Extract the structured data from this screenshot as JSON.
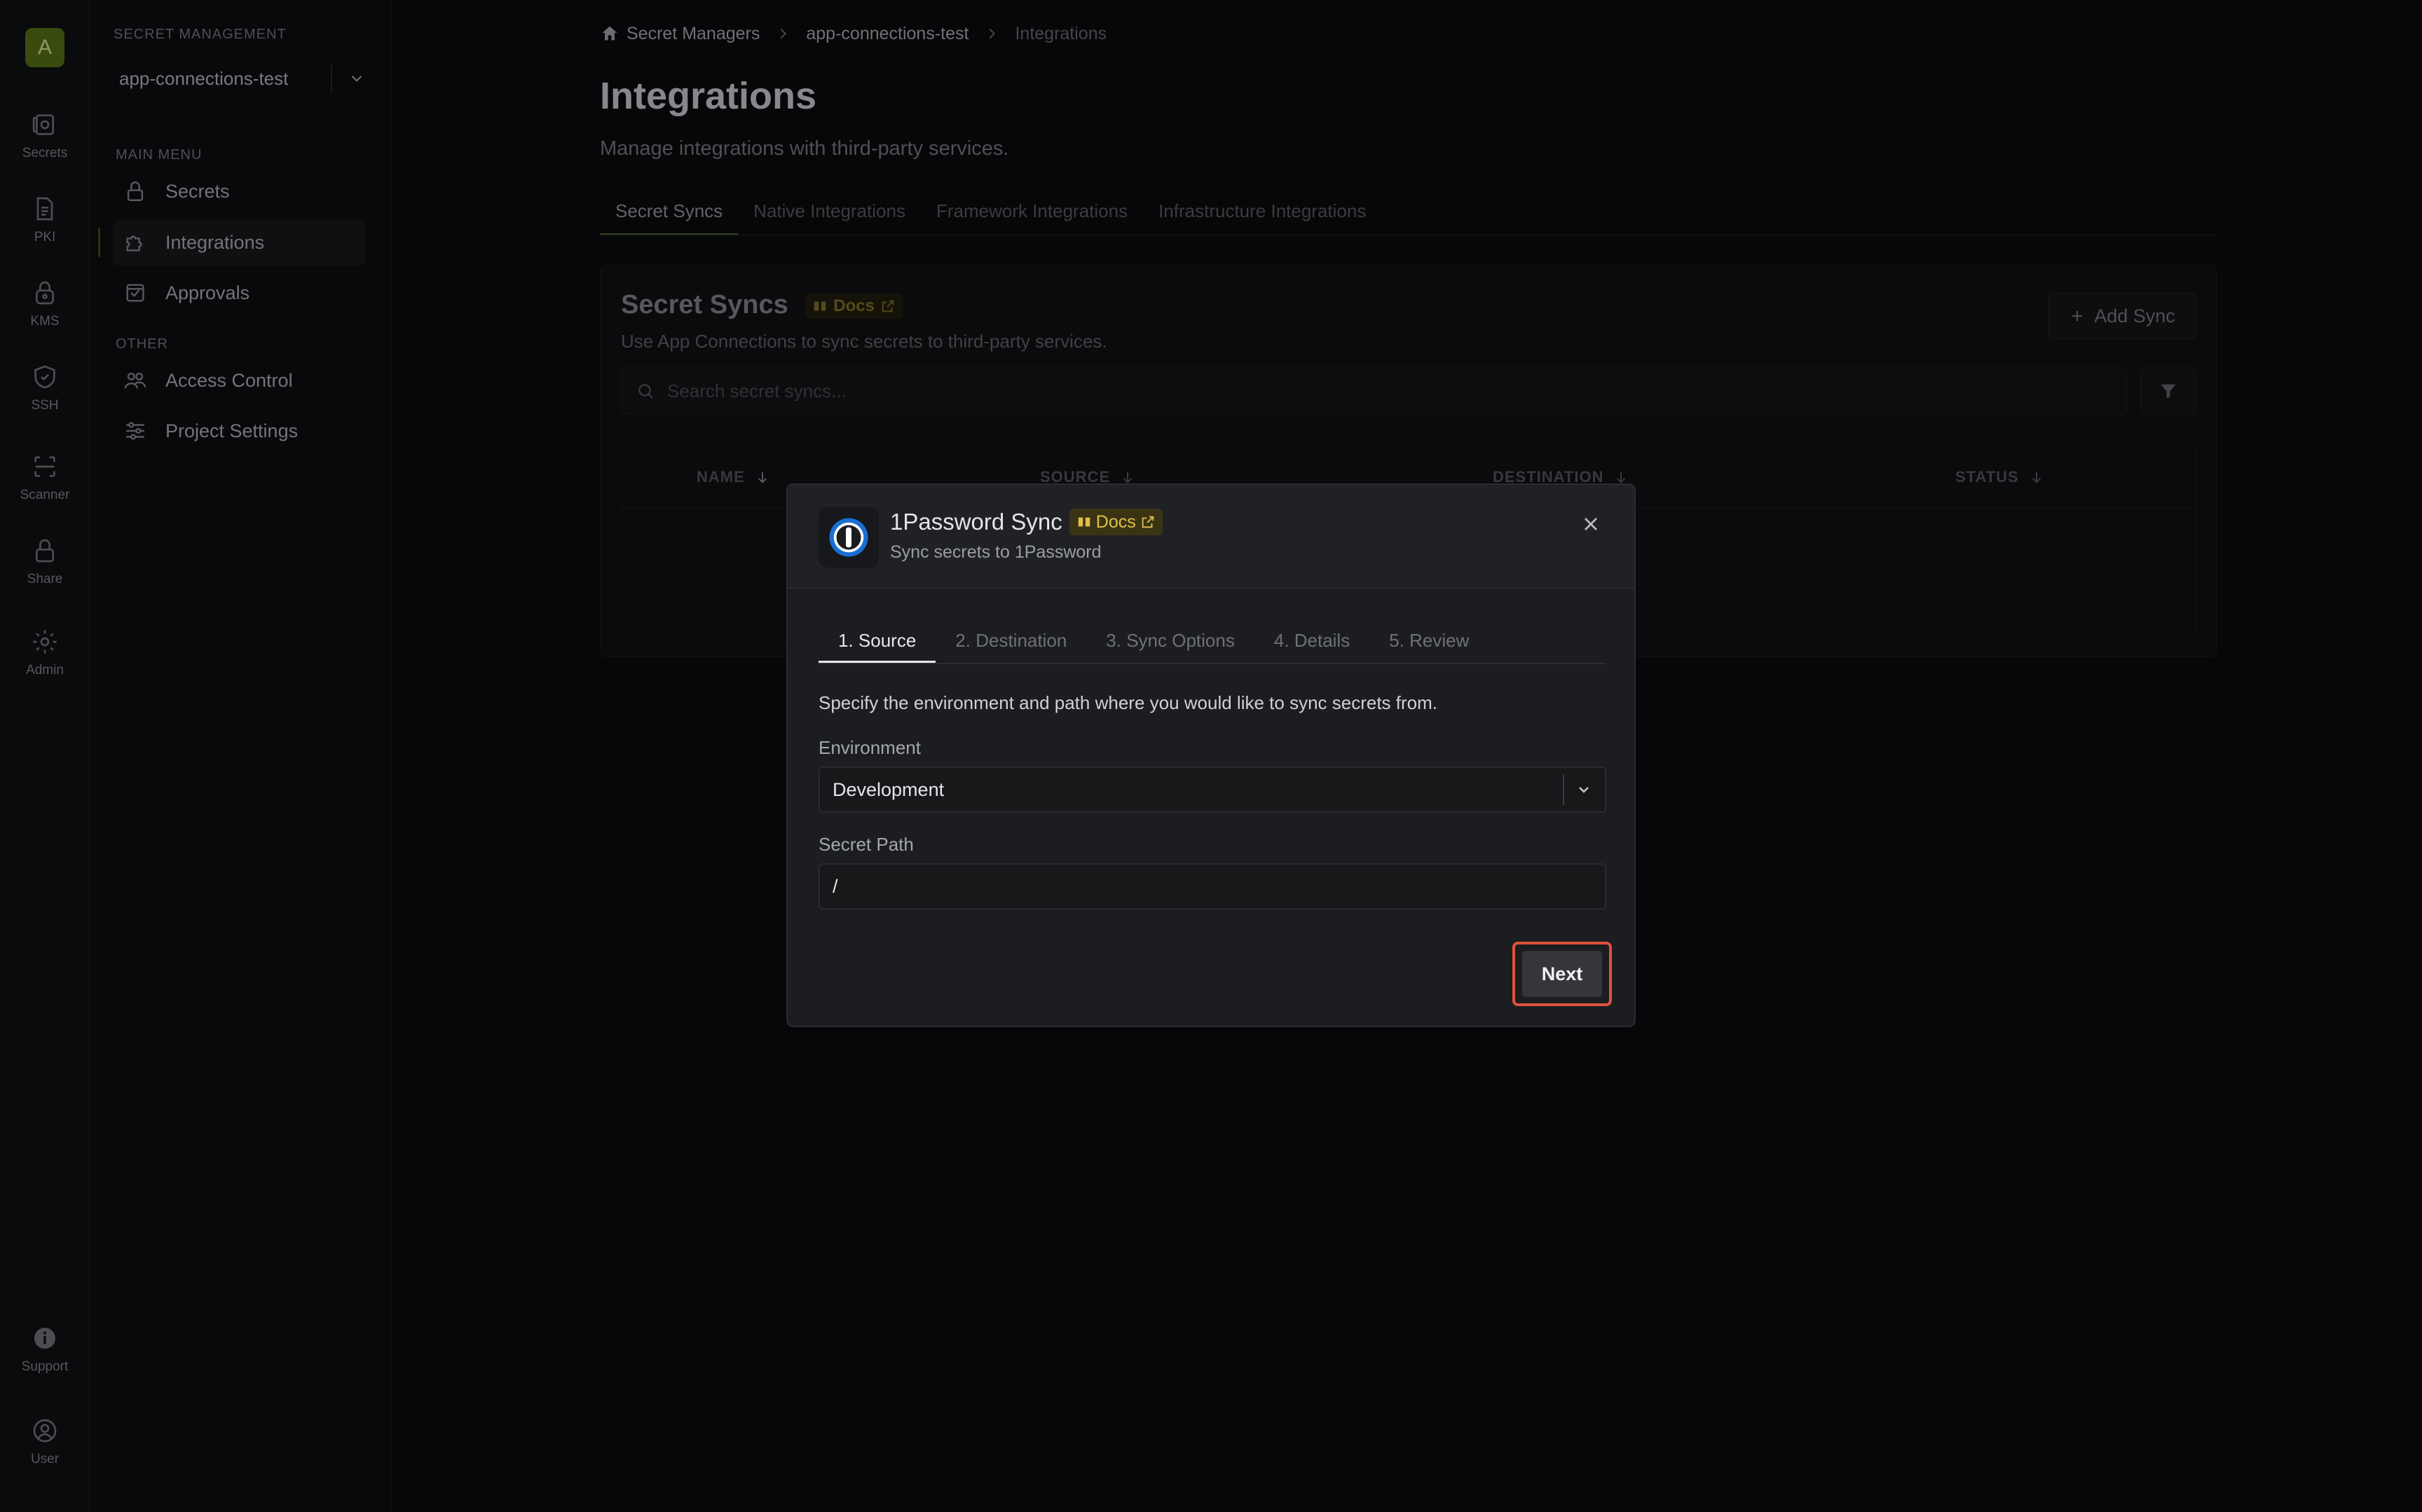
{
  "rail": {
    "avatar_letter": "A",
    "items": [
      {
        "label": "Secrets",
        "icon": "vault-icon"
      },
      {
        "label": "PKI",
        "icon": "certificate-icon"
      },
      {
        "label": "KMS",
        "icon": "key-lock-icon"
      },
      {
        "label": "SSH",
        "icon": "shield-icon"
      },
      {
        "label": "Scanner",
        "icon": "scan-icon"
      },
      {
        "label": "Share",
        "icon": "lock-icon"
      },
      {
        "label": "Admin",
        "icon": "gear-icon"
      },
      {
        "label": "Support",
        "icon": "info-icon"
      },
      {
        "label": "User",
        "icon": "user-icon"
      }
    ]
  },
  "sidebar": {
    "section_title": "SECRET MANAGEMENT",
    "project": "app-connections-test",
    "main_menu_label": "MAIN MENU",
    "main_items": [
      {
        "label": "Secrets",
        "icon": "lock-icon"
      },
      {
        "label": "Integrations",
        "icon": "puzzle-icon",
        "active": true
      },
      {
        "label": "Approvals",
        "icon": "checklist-icon"
      }
    ],
    "other_label": "OTHER",
    "other_items": [
      {
        "label": "Access Control",
        "icon": "users-icon"
      },
      {
        "label": "Project Settings",
        "icon": "sliders-icon"
      }
    ]
  },
  "breadcrumb": {
    "root": "Secret Managers",
    "project": "app-connections-test",
    "current": "Integrations"
  },
  "page": {
    "title": "Integrations",
    "subtitle": "Manage integrations with third-party services.",
    "tabs": [
      "Secret Syncs",
      "Native Integrations",
      "Framework Integrations",
      "Infrastructure Integrations"
    ],
    "active_tab": "Secret Syncs"
  },
  "panel": {
    "title": "Secret Syncs",
    "docs": "Docs",
    "subtitle": "Use App Connections to sync secrets to third-party services.",
    "add_button": "Add Sync",
    "search_placeholder": "Search secret syncs...",
    "columns": [
      "NAME",
      "SOURCE",
      "DESTINATION",
      "STATUS"
    ]
  },
  "modal": {
    "title": "1Password Sync",
    "docs": "Docs",
    "subtitle": "Sync secrets to 1Password",
    "steps": [
      "1. Source",
      "2. Destination",
      "3. Sync Options",
      "4. Details",
      "5. Review"
    ],
    "active_step": "1. Source",
    "description": "Specify the environment and path where you would like to sync secrets from.",
    "environment_label": "Environment",
    "environment_value": "Development",
    "path_label": "Secret Path",
    "path_value": "/",
    "next_button": "Next",
    "highlight_color": "#e0513d"
  }
}
